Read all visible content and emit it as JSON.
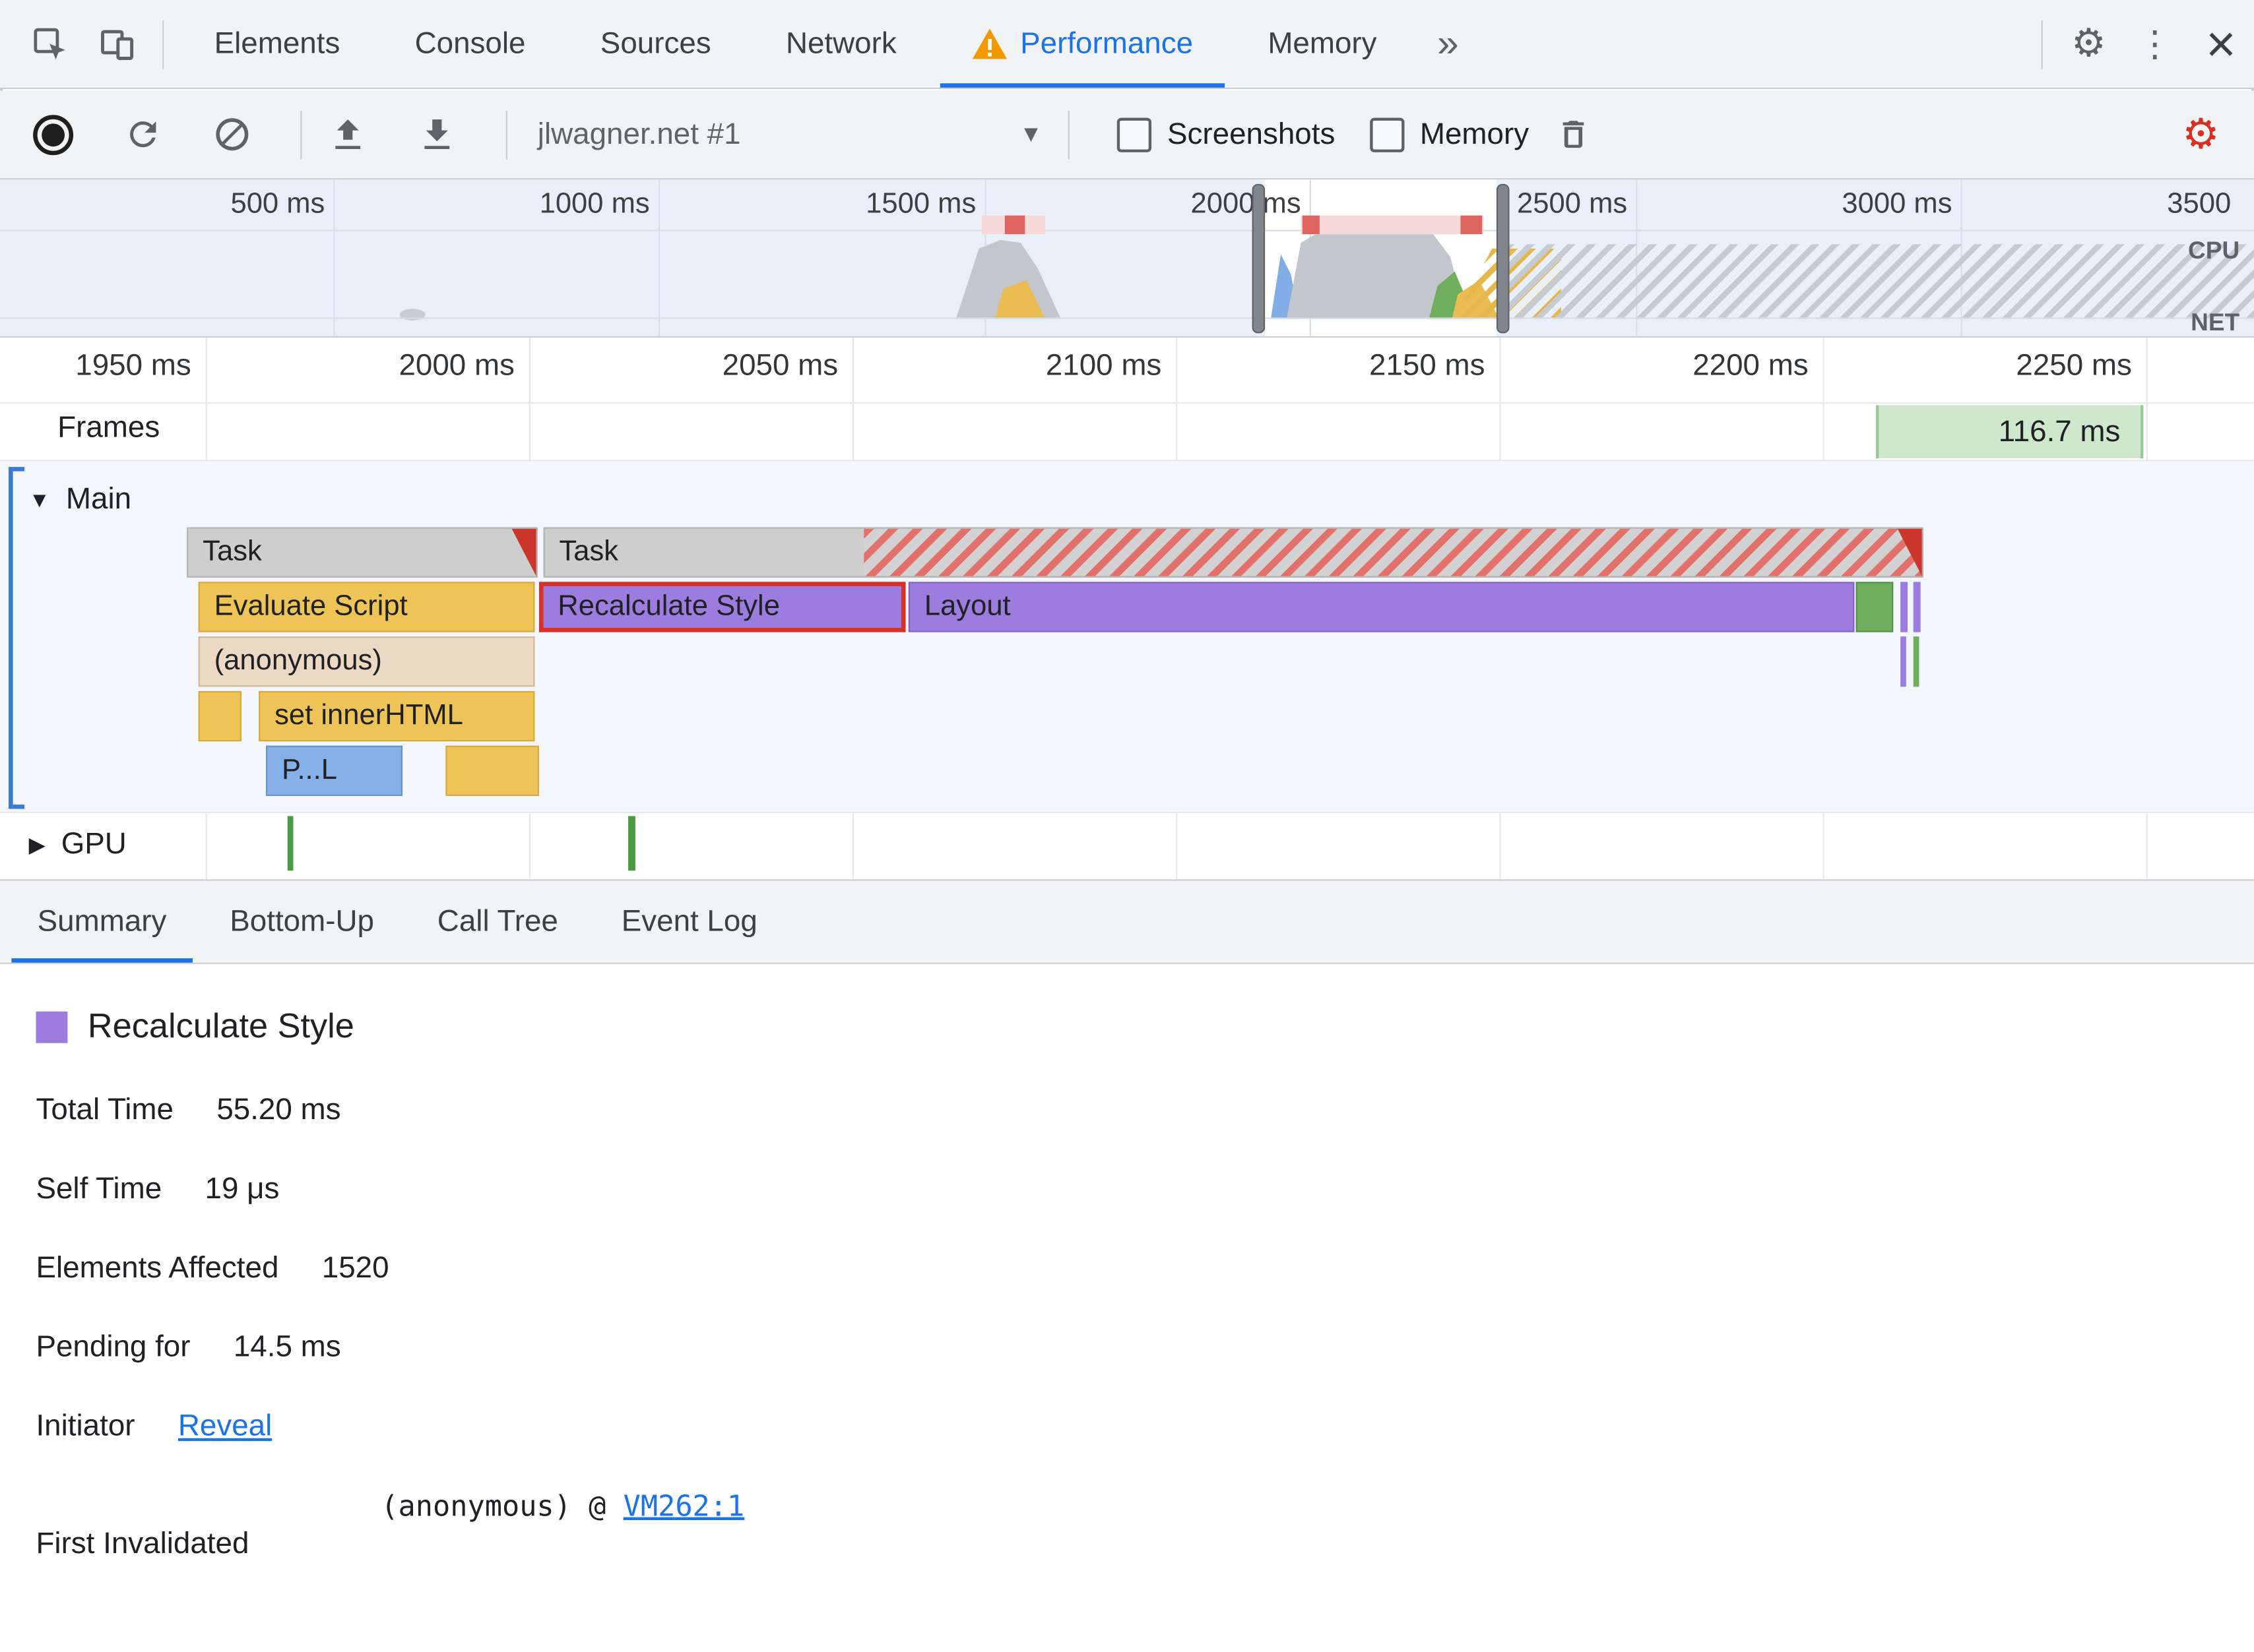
{
  "icons": {
    "settings": "⚙",
    "more_vertical": "⋮",
    "close": "×",
    "overflow_chevrons": "»",
    "dropdown_caret": "▾",
    "expanded_arrow": "▼",
    "collapsed_arrow": "▶"
  },
  "main_tabs": {
    "items": [
      "Elements",
      "Console",
      "Sources",
      "Network",
      "Performance",
      "Memory"
    ],
    "active": "Performance"
  },
  "toolbar": {
    "profile_select": "jlwagner.net #1",
    "screenshots_label": "Screenshots",
    "memory_label": "Memory"
  },
  "overview": {
    "ticks": [
      "500 ms",
      "1000 ms",
      "1500 ms",
      "2000 ms",
      "2500 ms",
      "3000 ms",
      "3500"
    ],
    "cpu_label": "CPU",
    "net_label": "NET"
  },
  "ruler": {
    "ticks": [
      "1950 ms",
      "2000 ms",
      "2050 ms",
      "2100 ms",
      "2150 ms",
      "2200 ms",
      "2250 ms"
    ]
  },
  "frames": {
    "label": "Frames",
    "badge": "116.7 ms"
  },
  "tracks": {
    "main": "Main",
    "gpu": "GPU"
  },
  "flame": {
    "task": "Task",
    "evaluate_script": "Evaluate Script",
    "recalculate_style": "Recalculate Style",
    "layout": "Layout",
    "anonymous": "(anonymous)",
    "set_inner_html": "set innerHTML",
    "parse_html_truncated": "P...L"
  },
  "bottom_tabs": {
    "items": [
      "Summary",
      "Bottom-Up",
      "Call Tree",
      "Event Log"
    ],
    "active": "Summary"
  },
  "summary": {
    "title": "Recalculate Style",
    "rows": [
      {
        "label": "Total Time",
        "value": "55.20 ms"
      },
      {
        "label": "Self Time",
        "value": "19 μs"
      },
      {
        "label": "Elements Affected",
        "value": "1520"
      },
      {
        "label": "Pending for",
        "value": "14.5 ms"
      }
    ],
    "initiator_label": "Initiator",
    "initiator_link": "Reveal",
    "first_invalidated_label": "First Invalidated",
    "first_invalidated_prefix": "(anonymous) @",
    "first_invalidated_link": "VM262:1"
  },
  "colors": {
    "accent": "#1a73e8",
    "warning": "#f29900",
    "selection_border": "#d93025",
    "task_gray": "#cecece",
    "script_yellow": "#efc457",
    "style_purple": "#9d7ce0",
    "paint_green": "#6fae5f",
    "parse_blue": "#86b1e8",
    "anonymous_tan": "#ecd9c4",
    "frames_badge_green": "#cfe8cd"
  }
}
